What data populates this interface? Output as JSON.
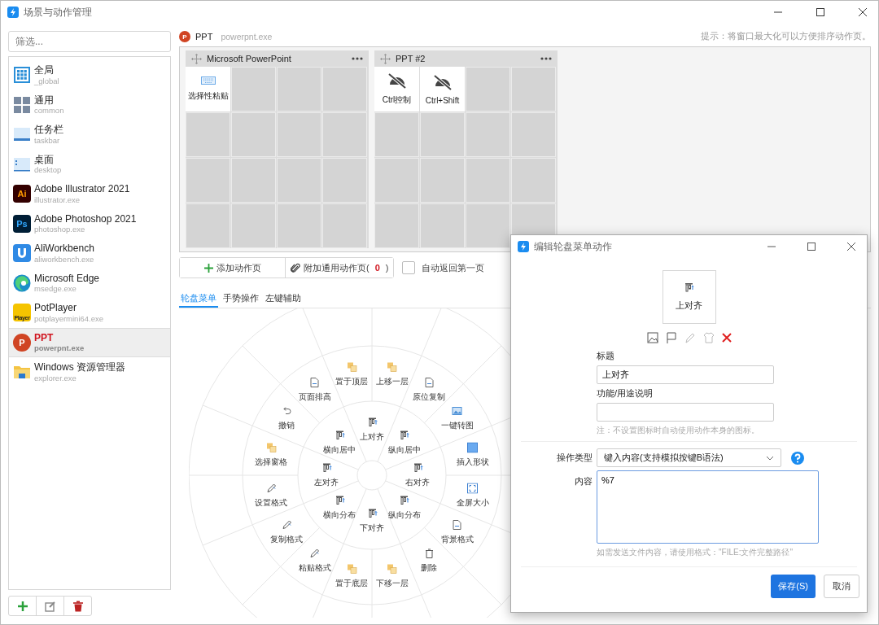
{
  "window": {
    "title": "场景与动作管理"
  },
  "sidebar": {
    "filter_placeholder": "筛选...",
    "items": [
      {
        "kind": "grid",
        "name": "全局",
        "exe": "_global",
        "selected": false
      },
      {
        "kind": "tiles",
        "name": "通用",
        "exe": "common",
        "selected": false
      },
      {
        "kind": "taskbar",
        "name": "任务栏",
        "exe": "taskbar",
        "selected": false
      },
      {
        "kind": "desktop",
        "name": "桌面",
        "exe": "desktop",
        "selected": false
      },
      {
        "kind": "ai",
        "logo_text": "Ai",
        "name": "Adobe Illustrator 2021",
        "exe": "illustrator.exe",
        "selected": false
      },
      {
        "kind": "ps",
        "logo_text": "Ps",
        "name": "Adobe Photoshop 2021",
        "exe": "photoshop.exe",
        "selected": false
      },
      {
        "kind": "ali",
        "name": "AliWorkbench",
        "exe": "aliworkbench.exe",
        "selected": false
      },
      {
        "kind": "edge",
        "name": "Microsoft Edge",
        "exe": "msedge.exe",
        "selected": false
      },
      {
        "kind": "player",
        "logo_text": "Player",
        "name": "PotPlayer",
        "exe": "potplayermini64.exe",
        "selected": false
      },
      {
        "kind": "ppt",
        "logo_text": "P",
        "name": "PPT",
        "exe": "powerpnt.exe",
        "selected": true
      },
      {
        "kind": "folder",
        "name": "Windows 资源管理器",
        "exe": "explorer.exe",
        "selected": false
      }
    ]
  },
  "app_header": {
    "logo_text": "P",
    "name": "PPT",
    "exe": "powerpnt.exe",
    "hint": "提示：将窗口最大化可以方便排序动作页。"
  },
  "pages": [
    {
      "title": "Microsoft PowerPoint",
      "actions": [
        {
          "kind": "keyboard",
          "label": "选择性粘贴"
        }
      ]
    },
    {
      "title": "PPT #2",
      "actions": [
        {
          "kind": "crossed",
          "label": "Ctrl控制"
        },
        {
          "kind": "crossed",
          "label": "Ctrl+Shift"
        }
      ]
    }
  ],
  "toolbar": {
    "add_page": "添加动作页",
    "attach_prefix": "附加通用动作页(",
    "attach_count": "0",
    "attach_suffix": ")",
    "auto_return": {
      "label": "自动返回第一页",
      "checked": false
    }
  },
  "tabs": [
    {
      "label": "轮盘菜单",
      "selected": true
    },
    {
      "label": "手势操作",
      "selected": false
    },
    {
      "label": "左键辅助",
      "selected": false
    }
  ],
  "wheel": {
    "inner": [
      {
        "kind": "align",
        "label": "上对齐"
      },
      {
        "kind": "align",
        "label": "横向居中"
      },
      {
        "kind": "align",
        "label": "纵向居中"
      },
      {
        "kind": "align",
        "label": "左对齐"
      },
      {
        "kind": "align",
        "label": "右对齐"
      },
      {
        "kind": "align",
        "label": "横向分布"
      },
      {
        "kind": "align",
        "label": "纵向分布"
      },
      {
        "kind": "align",
        "label": "下对齐"
      }
    ],
    "outer": [
      {
        "kind": "layer",
        "label": "置于顶层"
      },
      {
        "kind": "layer",
        "label": "上移一层"
      },
      {
        "kind": "document",
        "label": "页面排高"
      },
      {
        "kind": "document",
        "label": "原位复制"
      },
      {
        "kind": "undo",
        "label": "撤销"
      },
      {
        "kind": "image",
        "label": "一键转图"
      },
      {
        "kind": "layer",
        "label": "选择窗格"
      },
      {
        "kind": "shape",
        "label": "插入形状"
      },
      {
        "kind": "pen",
        "label": "设置格式"
      },
      {
        "kind": "fullscreen",
        "label": "全屏大小"
      },
      {
        "kind": "pen",
        "label": "复制格式"
      },
      {
        "kind": "document",
        "label": "背景格式"
      },
      {
        "kind": "pen",
        "label": "粘贴格式"
      },
      {
        "kind": "trash",
        "label": "删除"
      },
      {
        "kind": "layer",
        "label": "置于底层"
      },
      {
        "kind": "layer",
        "label": "下移一层"
      }
    ]
  },
  "dialog": {
    "title": "编辑轮盘菜单动作",
    "preview_label": "上对齐",
    "title_label": "标题",
    "title_value": "上对齐",
    "desc_label": "功能/用途说明",
    "note": "注：不设置图标时自动使用动作本身的图标。",
    "type_label": "操作类型",
    "type_value": "键入内容(支持模拟按键B语法)",
    "content_label": "内容",
    "content_value": "%7",
    "content_hint": "如需发送文件内容，请使用格式：\"FILE:文件完整路径\"",
    "save": "保存(S)",
    "cancel": "取消"
  }
}
